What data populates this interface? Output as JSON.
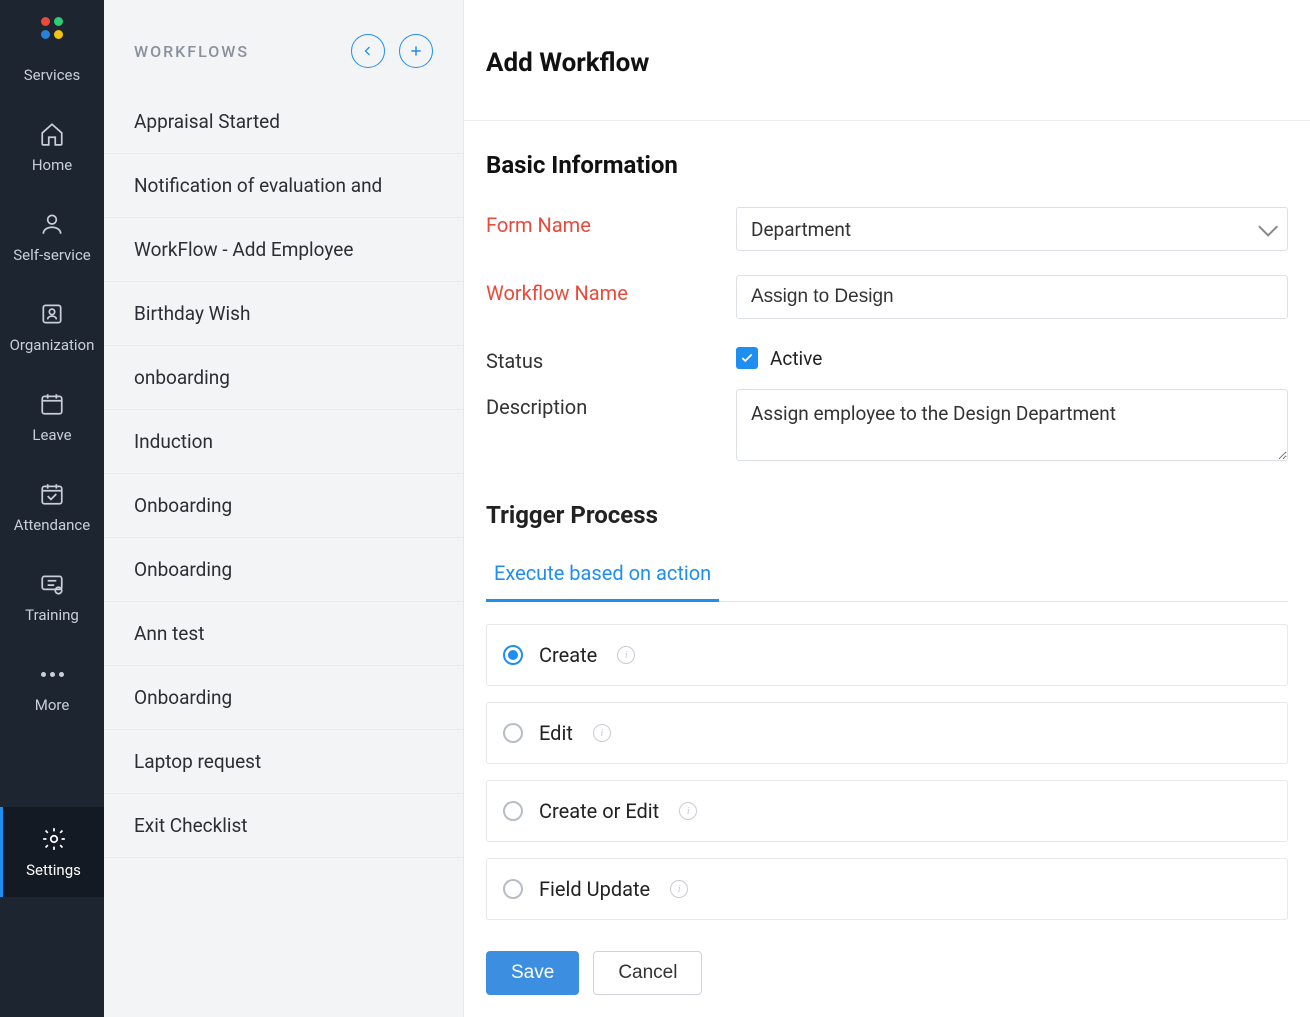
{
  "rail": {
    "logo_colors": [
      "#e84c3d",
      "#2ecc71",
      "#2980d9",
      "#f1c40f"
    ],
    "items": [
      {
        "label": "Services",
        "icon": "apps"
      },
      {
        "label": "Home",
        "icon": "home"
      },
      {
        "label": "Self-service",
        "icon": "person"
      },
      {
        "label": "Organization",
        "icon": "org"
      },
      {
        "label": "Leave",
        "icon": "calendar"
      },
      {
        "label": "Attendance",
        "icon": "clipboard"
      },
      {
        "label": "Training",
        "icon": "training"
      },
      {
        "label": "More",
        "icon": "more"
      },
      {
        "label": "Settings",
        "icon": "gear",
        "active": true
      }
    ]
  },
  "sidebar": {
    "title": "WORKFLOWS",
    "items": [
      "Appraisal Started",
      "Notification of evaluation and",
      "WorkFlow - Add Employee",
      "Birthday Wish",
      "onboarding",
      "Induction",
      "Onboarding",
      "Onboarding",
      "Ann test",
      "Onboarding",
      "Laptop request",
      "Exit Checklist"
    ]
  },
  "main": {
    "title": "Add Workflow",
    "basic_heading": "Basic Information",
    "labels": {
      "form_name": "Form Name",
      "workflow_name": "Workflow Name",
      "status": "Status",
      "description": "Description",
      "active": "Active"
    },
    "values": {
      "form_name": "Department",
      "workflow_name": "Assign to Design",
      "status_active": true,
      "description": "Assign employee to the Design Department"
    },
    "trigger": {
      "heading": "Trigger Process",
      "tab": "Execute based on action",
      "options": [
        {
          "label": "Create",
          "checked": true
        },
        {
          "label": "Edit",
          "checked": false
        },
        {
          "label": "Create or Edit",
          "checked": false
        },
        {
          "label": "Field Update",
          "checked": false
        }
      ]
    },
    "footer": {
      "save": "Save",
      "cancel": "Cancel"
    }
  }
}
